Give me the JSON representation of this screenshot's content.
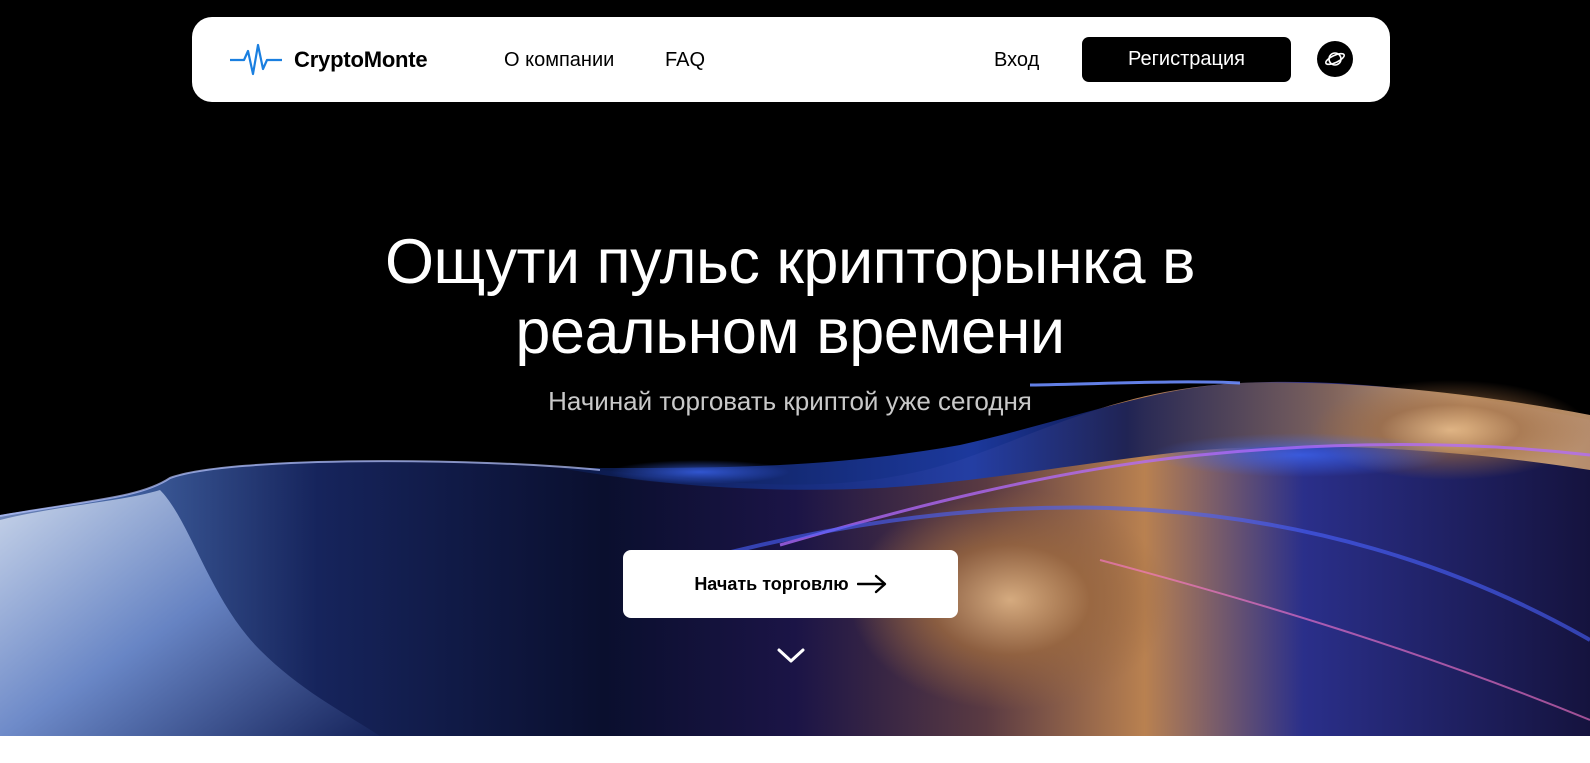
{
  "header": {
    "logo_text": "CryptoMonte",
    "logo_icon": "pulse-icon",
    "nav": {
      "about": "О компании",
      "faq": "FAQ",
      "login": "Вход"
    },
    "register_label": "Регистрация",
    "language_icon": "globe-icon"
  },
  "hero": {
    "title": "Ощути пульс крипторынка в реальном времени",
    "subtitle": "Начинай торговать криптой уже сегодня",
    "cta_label": "Начать торговлю",
    "cta_icon": "arrow-right-icon",
    "scroll_icon": "chevron-down-icon"
  },
  "colors": {
    "background": "#000000",
    "header_bg": "#ffffff",
    "brand_accent": "#1a7fe0",
    "wave_blue": "#2a4be8",
    "wave_purple": "#8a3ad8",
    "wave_gold": "#c8864a"
  }
}
